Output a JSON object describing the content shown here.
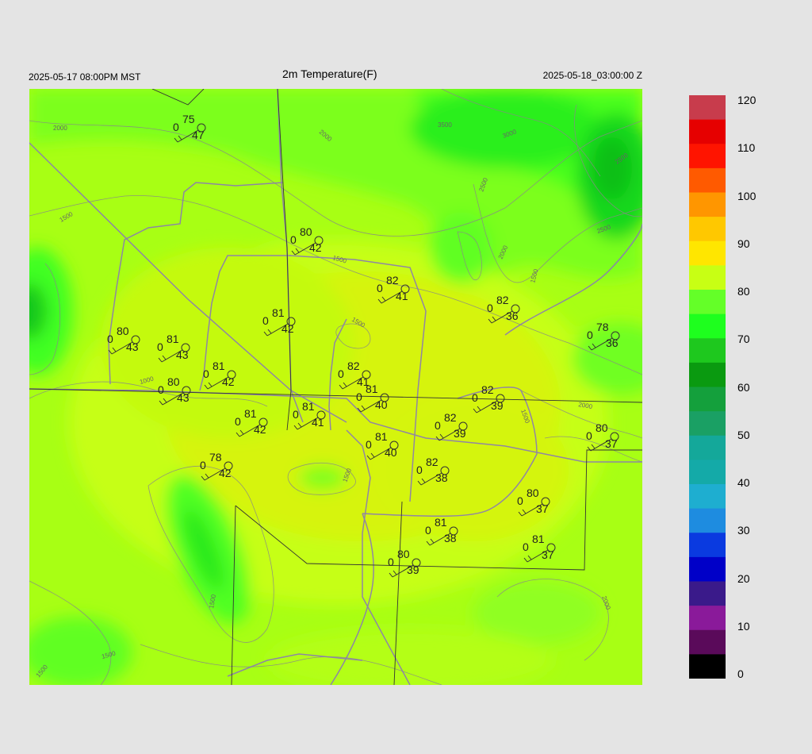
{
  "header": {
    "left": "2025-05-17 08:00PM MST",
    "center": "2m Temperature(F)",
    "right": "2025-05-18_03:00:00 Z"
  },
  "colorbar": {
    "labels": [
      "120",
      "110",
      "100",
      "90",
      "80",
      "70",
      "60",
      "50",
      "40",
      "30",
      "20",
      "10",
      "0"
    ],
    "stops": [
      {
        "value": 0,
        "color": "#000000"
      },
      {
        "value": 5,
        "color": "#5a0a5a"
      },
      {
        "value": 10,
        "color": "#8a1a9a"
      },
      {
        "value": 15,
        "color": "#3a1a8a"
      },
      {
        "value": 20,
        "color": "#0000c8"
      },
      {
        "value": 25,
        "color": "#0a3ae0"
      },
      {
        "value": 30,
        "color": "#1e8ce0"
      },
      {
        "value": 35,
        "color": "#1eaed0"
      },
      {
        "value": 40,
        "color": "#14aaa8"
      },
      {
        "value": 45,
        "color": "#14a89a"
      },
      {
        "value": 50,
        "color": "#1aa064"
      },
      {
        "value": 55,
        "color": "#14a03c"
      },
      {
        "value": 60,
        "color": "#0a9a10"
      },
      {
        "value": 65,
        "color": "#1ec81e"
      },
      {
        "value": 70,
        "color": "#1eff1e"
      },
      {
        "value": 75,
        "color": "#64ff28"
      },
      {
        "value": 80,
        "color": "#c8ff14"
      },
      {
        "value": 85,
        "color": "#ffe600"
      },
      {
        "value": 90,
        "color": "#ffc800"
      },
      {
        "value": 95,
        "color": "#ff9600"
      },
      {
        "value": 100,
        "color": "#ff5a00"
      },
      {
        "value": 105,
        "color": "#ff1400"
      },
      {
        "value": 110,
        "color": "#e60000"
      },
      {
        "value": 115,
        "color": "#c83c4c"
      },
      {
        "value": 120,
        "color": "#d8d8d8"
      }
    ]
  },
  "contours": [
    "1000",
    "1500",
    "1500",
    "1500",
    "1500",
    "1500",
    "1500",
    "1500",
    "1500",
    "1500",
    "2000",
    "2000",
    "2000",
    "2000",
    "2000",
    "2500",
    "2500",
    "2500",
    "3000",
    "3500"
  ],
  "stations": [
    {
      "t": "75",
      "d": "47",
      "p": "0"
    },
    {
      "t": "80",
      "d": "42",
      "p": "0"
    },
    {
      "t": "82",
      "d": "41",
      "p": "0"
    },
    {
      "t": "82",
      "d": "36",
      "p": "0"
    },
    {
      "t": "78",
      "d": "36",
      "p": "0"
    },
    {
      "t": "80",
      "d": "43",
      "p": "0"
    },
    {
      "t": "81",
      "d": "43",
      "p": "0"
    },
    {
      "t": "81",
      "d": "42",
      "p": "0"
    },
    {
      "t": "82",
      "d": "41",
      "p": "0"
    },
    {
      "t": "80",
      "d": "43",
      "p": "0"
    },
    {
      "t": "81",
      "d": "42",
      "p": "0"
    },
    {
      "t": "81",
      "d": "40",
      "p": "0"
    },
    {
      "t": "82",
      "d": "39",
      "p": "0"
    },
    {
      "t": "81",
      "d": "41",
      "p": "0"
    },
    {
      "t": "82",
      "d": "39",
      "p": "0"
    },
    {
      "t": "80",
      "d": "37",
      "p": "0"
    },
    {
      "t": "81",
      "d": "42",
      "p": "0"
    },
    {
      "t": "81",
      "d": "40",
      "p": "0"
    },
    {
      "t": "78",
      "d": "42",
      "p": "0"
    },
    {
      "t": "82",
      "d": "38",
      "p": "0"
    },
    {
      "t": "80",
      "d": "37",
      "p": "0"
    },
    {
      "t": "81",
      "d": "38",
      "p": "0"
    },
    {
      "t": "81",
      "d": "37",
      "p": "0"
    },
    {
      "t": "80",
      "d": "39",
      "p": "0"
    }
  ]
}
